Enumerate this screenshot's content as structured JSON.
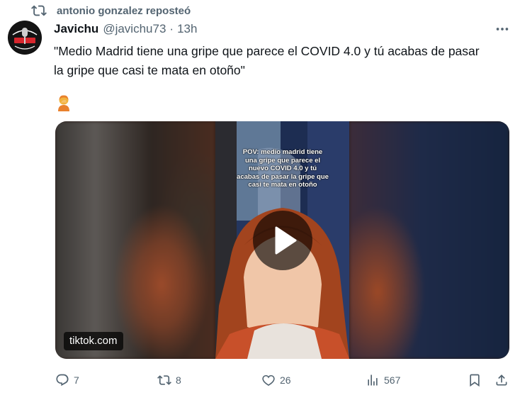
{
  "repost": {
    "label": "antonio gonzalez reposteó",
    "icon": "repost-icon"
  },
  "tweet": {
    "author_name": "Javichu",
    "author_handle": "@javichu73",
    "separator": "·",
    "timestamp": "13h",
    "text_line1": "\"Medio Madrid tiene una gripe que parece el COVID 4.0 y tú acabas de pasar",
    "text_line2": "la gripe que casi te mata en otoño\"",
    "emoji_icon": "person-facepalming-emoji"
  },
  "media": {
    "overlay_lines": [
      "POV: medio madrid tiene",
      "una gripe que parece el",
      "nuevo COVID 4.0 y tú",
      "acabas de pasar la gripe que",
      "casi te mata en otoño"
    ],
    "source_label": "tiktok.com"
  },
  "actions": {
    "reply_count": "7",
    "repost_count": "8",
    "like_count": "26",
    "views_count": "567"
  },
  "colors": {
    "secondary_text": "#536471",
    "primary_text": "#0f1419"
  }
}
